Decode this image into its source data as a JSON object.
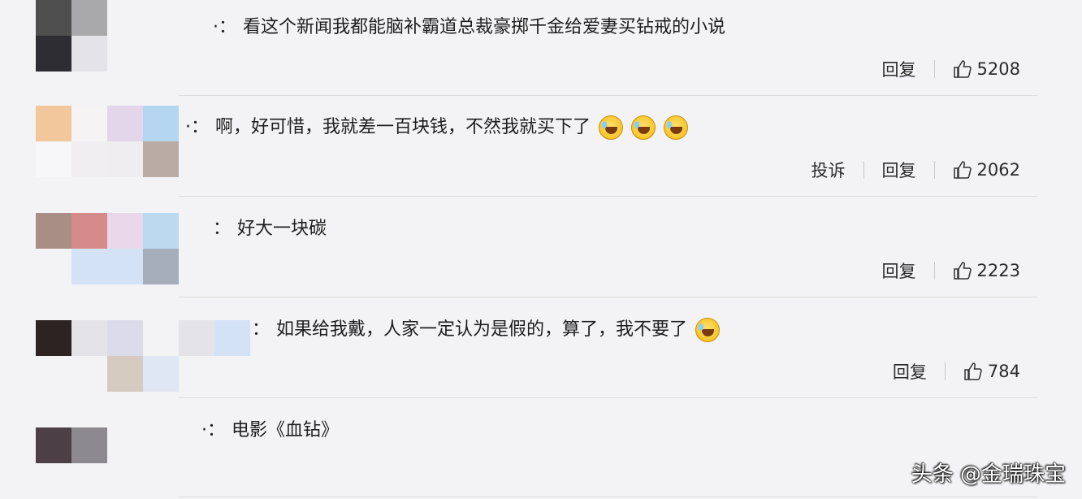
{
  "comments": [
    {
      "text": "看这个新闻我都能脑补霸道总裁豪掷千金给爱妻买钻戒的小说",
      "actions": [
        "回复"
      ],
      "likes": "5208",
      "emoji_count": 0,
      "avatar_colors": [
        "#4e4e4e",
        "#a9a9ab",
        "#2e2d33",
        "#e4e4e8"
      ]
    },
    {
      "text": "啊，好可惜，我就差一百块钱，不然我就买下了",
      "actions": [
        "投诉",
        "回复"
      ],
      "likes": "2062",
      "emoji_count": 3,
      "avatar_colors": [
        "#f1c79b",
        "#f5f3f4",
        "#e3d6ea",
        "#b4d6f1",
        "#f7f7f9",
        "#f1eef2",
        "#efedf0",
        "#b9aca4"
      ]
    },
    {
      "text": "好大一块碳",
      "actions": [
        "回复"
      ],
      "likes": "2223",
      "emoji_count": 0,
      "avatar_colors": [
        "#a88e85",
        "#d58b8a",
        "#e9d8e9",
        "#bcd9ef",
        "#f3f2f4",
        "#f3f2f4",
        "#d4e2f6",
        "#a6aeba"
      ]
    },
    {
      "text": "如果给我戴，人家一定认为是假的，算了，我不要了",
      "actions": [
        "回复"
      ],
      "likes": "784",
      "emoji_count": 1,
      "avatar_colors": [
        "#2d2322",
        "#e4e4e8",
        "#dcdbe9",
        "#f3f2f4",
        "#f3f2f4",
        "#f3f2f4",
        "#d6cbc0",
        "#dfe6f4"
      ]
    },
    {
      "text": "电影《血钻》",
      "actions": [],
      "likes": "",
      "emoji_count": 0,
      "avatar_colors": [
        "#4c4046",
        "#8c8a8e"
      ]
    }
  ],
  "watermark": "头条 @金瑞珠宝",
  "colors": {
    "background": "#f3f2f4",
    "text": "#1e1e1e",
    "divider": "#dcdcdc"
  }
}
